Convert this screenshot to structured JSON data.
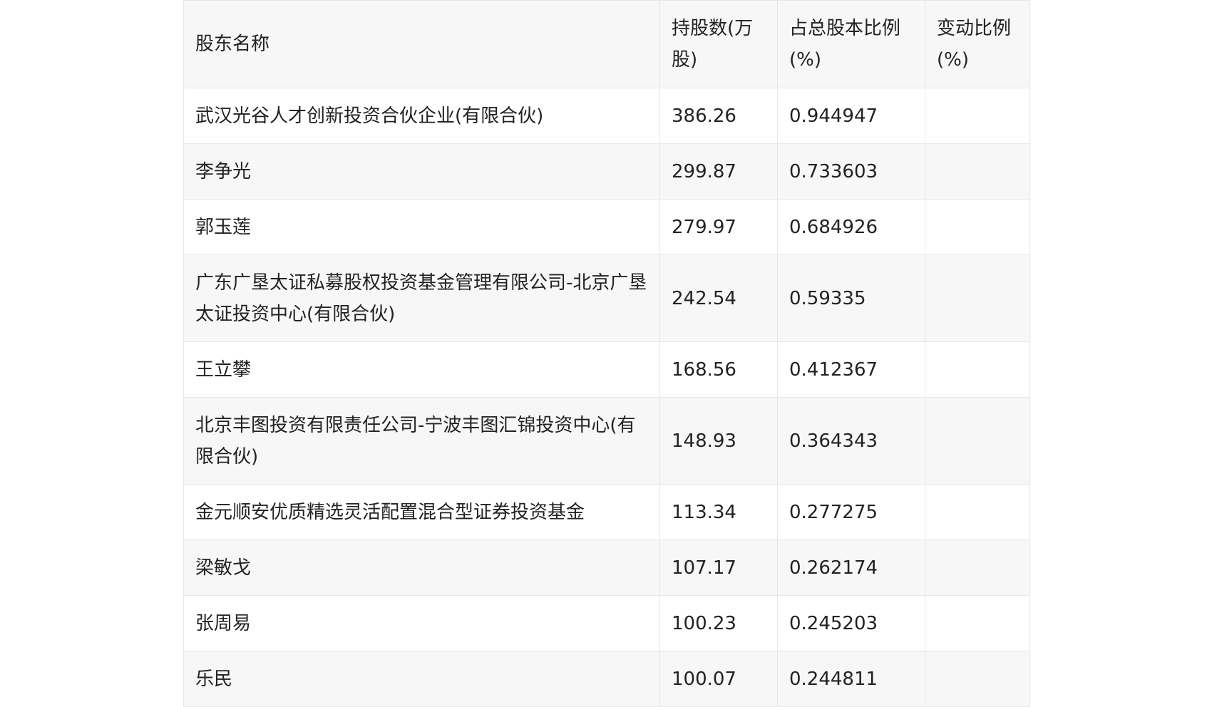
{
  "table": {
    "headers": {
      "name": "股东名称",
      "shares": "持股数(万股)",
      "ratio": "占总股本比例(%)",
      "change": "变动比例(%)"
    },
    "rows": [
      {
        "name": "武汉光谷人才创新投资合伙企业(有限合伙)",
        "shares": "386.26",
        "ratio": "0.944947",
        "change": ""
      },
      {
        "name": "李争光",
        "shares": "299.87",
        "ratio": "0.733603",
        "change": ""
      },
      {
        "name": "郭玉莲",
        "shares": "279.97",
        "ratio": "0.684926",
        "change": ""
      },
      {
        "name": "广东广垦太证私募股权投资基金管理有限公司-北京广垦太证投资中心(有限合伙)",
        "shares": "242.54",
        "ratio": "0.59335",
        "change": ""
      },
      {
        "name": "王立攀",
        "shares": "168.56",
        "ratio": "0.412367",
        "change": ""
      },
      {
        "name": "北京丰图投资有限责任公司-宁波丰图汇锦投资中心(有限合伙)",
        "shares": "148.93",
        "ratio": "0.364343",
        "change": ""
      },
      {
        "name": "金元顺安优质精选灵活配置混合型证券投资基金",
        "shares": "113.34",
        "ratio": "0.277275",
        "change": ""
      },
      {
        "name": "梁敏戈",
        "shares": "107.17",
        "ratio": "0.262174",
        "change": ""
      },
      {
        "name": "张周易",
        "shares": "100.23",
        "ratio": "0.245203",
        "change": ""
      },
      {
        "name": "乐民",
        "shares": "100.07",
        "ratio": "0.244811",
        "change": ""
      }
    ]
  }
}
